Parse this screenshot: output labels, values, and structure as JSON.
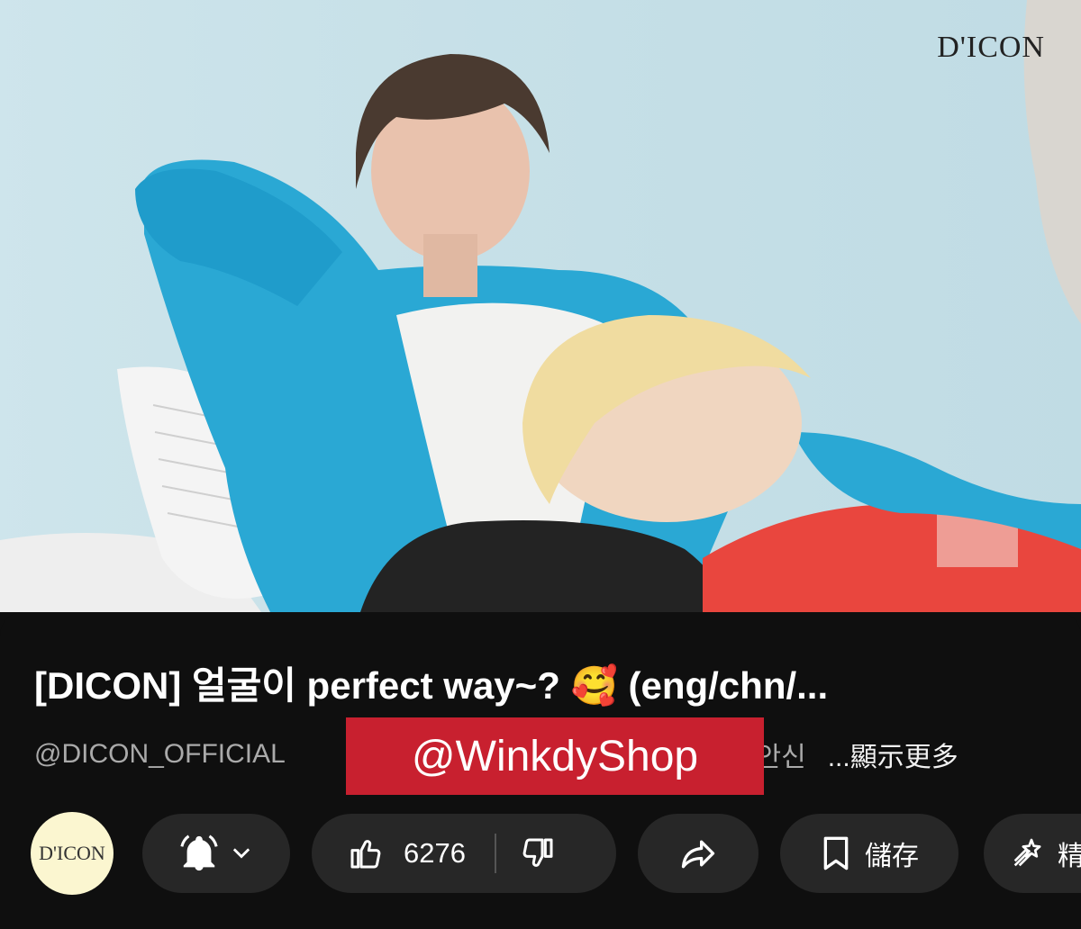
{
  "video": {
    "brand_logo": "D'ICON"
  },
  "title": "[DICON] 얼굴이 perfect way~? 🥰 (eng/chn/...",
  "meta": {
    "channel": "@DICON_OFFICIAL",
    "hashtag": "#안신",
    "more": "...顯示更多"
  },
  "watermark": "@WinkdyShop",
  "channel_avatar": "D'ICON",
  "actions": {
    "like_count": "6276",
    "save_label": "儲存",
    "clip_label": "精"
  },
  "icons": [
    "bell-icon",
    "chevron-down-icon",
    "thumbs-up-icon",
    "thumbs-down-icon",
    "share-icon",
    "bookmark-icon",
    "clip-icon"
  ],
  "colors": {
    "background": "#0f0f0f",
    "pill": "#272727",
    "watermark": "#c8202f",
    "avatar_bg": "#fbf6d0"
  }
}
